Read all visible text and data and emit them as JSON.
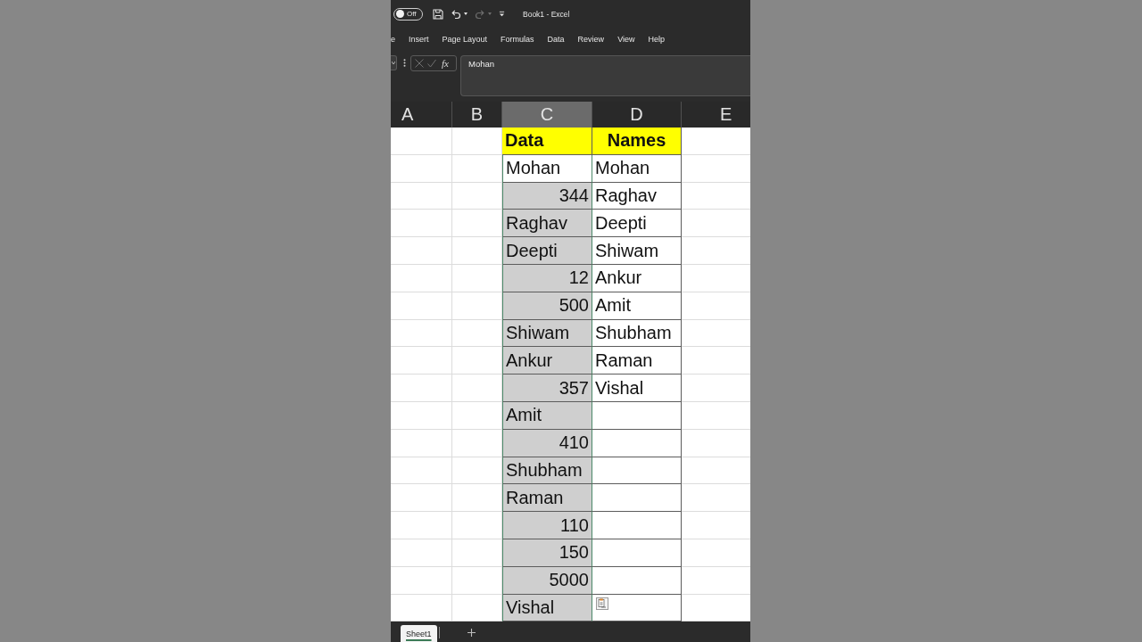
{
  "title_bar": {
    "autosave": {
      "label": "Off",
      "on": false
    },
    "quick_access": [
      {
        "kind": "save",
        "disabled": false,
        "menu": false
      },
      {
        "kind": "undo",
        "disabled": false,
        "menu": true
      },
      {
        "kind": "redo",
        "disabled": true,
        "menu": true
      },
      {
        "kind": "customize",
        "disabled": false,
        "menu": false
      }
    ],
    "title": "Book1 - Excel"
  },
  "ribbon_tabs": [
    {
      "label": "e",
      "selected": false
    },
    {
      "label": "Insert",
      "selected": false
    },
    {
      "label": "Page Layout",
      "selected": false
    },
    {
      "label": "Formulas",
      "selected": false
    },
    {
      "label": "Data",
      "selected": false
    },
    {
      "label": "Review",
      "selected": false
    },
    {
      "label": "View",
      "selected": false
    },
    {
      "label": "Help",
      "selected": false
    }
  ],
  "formula_bar": {
    "buttons_disabled": true,
    "function_label": "fx",
    "formula": "Mohan"
  },
  "sheet": {
    "columns": [
      {
        "label": "A",
        "selected": false
      },
      {
        "label": "B",
        "selected": false
      },
      {
        "label": "C",
        "selected": true
      },
      {
        "label": "D",
        "selected": false
      },
      {
        "label": "E",
        "selected": false
      }
    ],
    "rows": [
      {
        "data": {
          "value": "Data",
          "kind": "header",
          "selected": false,
          "active": false
        },
        "names": {
          "value": "Names",
          "kind": "header",
          "selected": false
        }
      },
      {
        "data": {
          "value": "Mohan",
          "kind": "text",
          "selected": true,
          "active": true
        },
        "names": {
          "value": "Mohan",
          "kind": "text",
          "selected": false
        }
      },
      {
        "data": {
          "value": "344",
          "kind": "number",
          "selected": true,
          "active": false
        },
        "names": {
          "value": "Raghav",
          "kind": "text",
          "selected": false
        }
      },
      {
        "data": {
          "value": "Raghav",
          "kind": "text",
          "selected": true,
          "active": false
        },
        "names": {
          "value": "Deepti",
          "kind": "text",
          "selected": false
        }
      },
      {
        "data": {
          "value": "Deepti",
          "kind": "text",
          "selected": true,
          "active": false
        },
        "names": {
          "value": "Shiwam",
          "kind": "text",
          "selected": false
        }
      },
      {
        "data": {
          "value": "12",
          "kind": "number",
          "selected": true,
          "active": false
        },
        "names": {
          "value": "Ankur",
          "kind": "text",
          "selected": false
        }
      },
      {
        "data": {
          "value": "500",
          "kind": "number",
          "selected": true,
          "active": false
        },
        "names": {
          "value": "Amit",
          "kind": "text",
          "selected": false
        }
      },
      {
        "data": {
          "value": "Shiwam",
          "kind": "text",
          "selected": true,
          "active": false
        },
        "names": {
          "value": "Shubham",
          "kind": "text",
          "selected": false
        }
      },
      {
        "data": {
          "value": "Ankur",
          "kind": "text",
          "selected": true,
          "active": false
        },
        "names": {
          "value": "Raman",
          "kind": "text",
          "selected": false
        }
      },
      {
        "data": {
          "value": "357",
          "kind": "number",
          "selected": true,
          "active": false
        },
        "names": {
          "value": "Vishal",
          "kind": "text",
          "selected": false
        }
      },
      {
        "data": {
          "value": "Amit",
          "kind": "text",
          "selected": true,
          "active": false
        },
        "names": {
          "kind": "empty",
          "selected": false
        }
      },
      {
        "data": {
          "value": "410",
          "kind": "number",
          "selected": true,
          "active": false
        },
        "names": {
          "kind": "empty",
          "selected": false
        }
      },
      {
        "data": {
          "value": "Shubham",
          "kind": "text",
          "selected": true,
          "active": false
        },
        "names": {
          "kind": "empty",
          "selected": false
        }
      },
      {
        "data": {
          "value": "Raman",
          "kind": "text",
          "selected": true,
          "active": false
        },
        "names": {
          "kind": "empty",
          "selected": false
        }
      },
      {
        "data": {
          "value": "110",
          "kind": "number",
          "selected": true,
          "active": false
        },
        "names": {
          "kind": "empty",
          "selected": false
        }
      },
      {
        "data": {
          "value": "150",
          "kind": "number",
          "selected": true,
          "active": false
        },
        "names": {
          "kind": "empty",
          "selected": false
        }
      },
      {
        "data": {
          "value": "5000",
          "kind": "number",
          "selected": true,
          "active": false
        },
        "names": {
          "kind": "empty",
          "selected": false
        }
      },
      {
        "data": {
          "value": "Vishal",
          "kind": "text",
          "selected": true,
          "active": false
        },
        "names": {
          "kind": "empty",
          "selected": false,
          "paste_options": true
        }
      }
    ]
  },
  "sheet_tabs": [
    {
      "label": "Sheet1",
      "selected": true
    }
  ]
}
